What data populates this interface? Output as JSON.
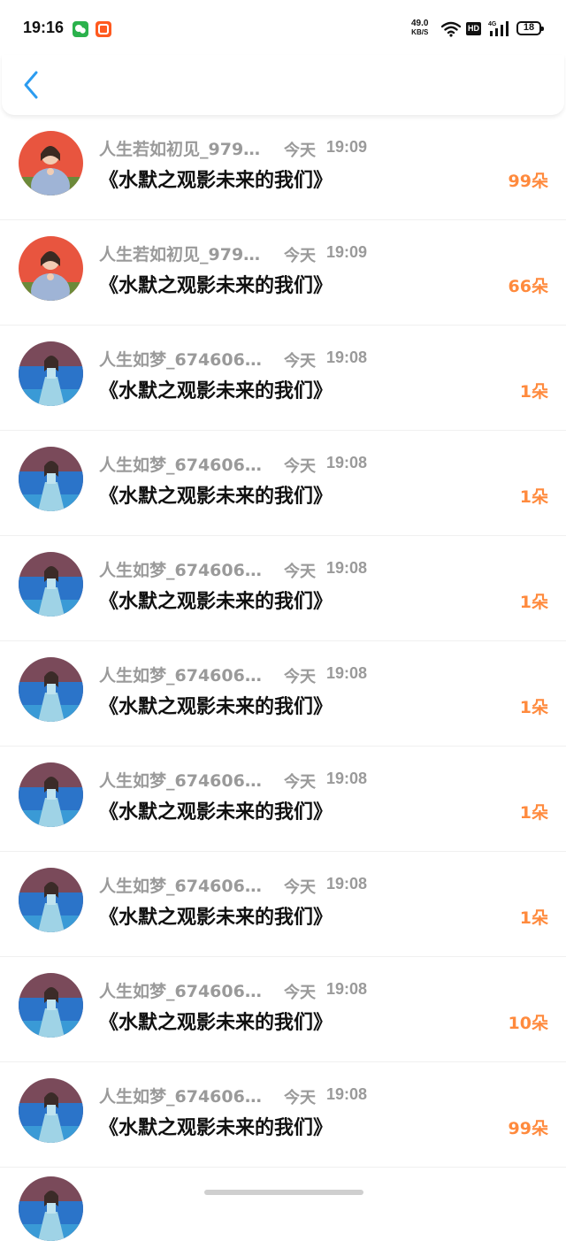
{
  "status_bar": {
    "time": "19:16",
    "speed_value": "49.0",
    "speed_unit": "KB/S",
    "hd_label": "HD",
    "network_type": "4G",
    "battery": "18"
  },
  "header": {
    "back_icon": "chevron-left-icon",
    "accent_color": "#2c9cf0"
  },
  "gift_color": "#ff8a3d",
  "rows": [
    {
      "nickname": "人生若如初见_979…",
      "date": "今天",
      "time": "19:09",
      "title": "《水默之观影未来的我们》",
      "count": "99朵",
      "avatar": "red"
    },
    {
      "nickname": "人生若如初见_979…",
      "date": "今天",
      "time": "19:09",
      "title": "《水默之观影未来的我们》",
      "count": "66朵",
      "avatar": "red"
    },
    {
      "nickname": "人生如梦_674606…",
      "date": "今天",
      "time": "19:08",
      "title": "《水默之观影未来的我们》",
      "count": "1朵",
      "avatar": "blue"
    },
    {
      "nickname": "人生如梦_674606…",
      "date": "今天",
      "time": "19:08",
      "title": "《水默之观影未来的我们》",
      "count": "1朵",
      "avatar": "blue"
    },
    {
      "nickname": "人生如梦_674606…",
      "date": "今天",
      "time": "19:08",
      "title": "《水默之观影未来的我们》",
      "count": "1朵",
      "avatar": "blue"
    },
    {
      "nickname": "人生如梦_674606…",
      "date": "今天",
      "time": "19:08",
      "title": "《水默之观影未来的我们》",
      "count": "1朵",
      "avatar": "blue"
    },
    {
      "nickname": "人生如梦_674606…",
      "date": "今天",
      "time": "19:08",
      "title": "《水默之观影未来的我们》",
      "count": "1朵",
      "avatar": "blue"
    },
    {
      "nickname": "人生如梦_674606…",
      "date": "今天",
      "time": "19:08",
      "title": "《水默之观影未来的我们》",
      "count": "1朵",
      "avatar": "blue"
    },
    {
      "nickname": "人生如梦_674606…",
      "date": "今天",
      "time": "19:08",
      "title": "《水默之观影未来的我们》",
      "count": "10朵",
      "avatar": "blue"
    },
    {
      "nickname": "人生如梦_674606…",
      "date": "今天",
      "time": "19:08",
      "title": "《水默之观影未来的我们》",
      "count": "99朵",
      "avatar": "blue"
    }
  ]
}
